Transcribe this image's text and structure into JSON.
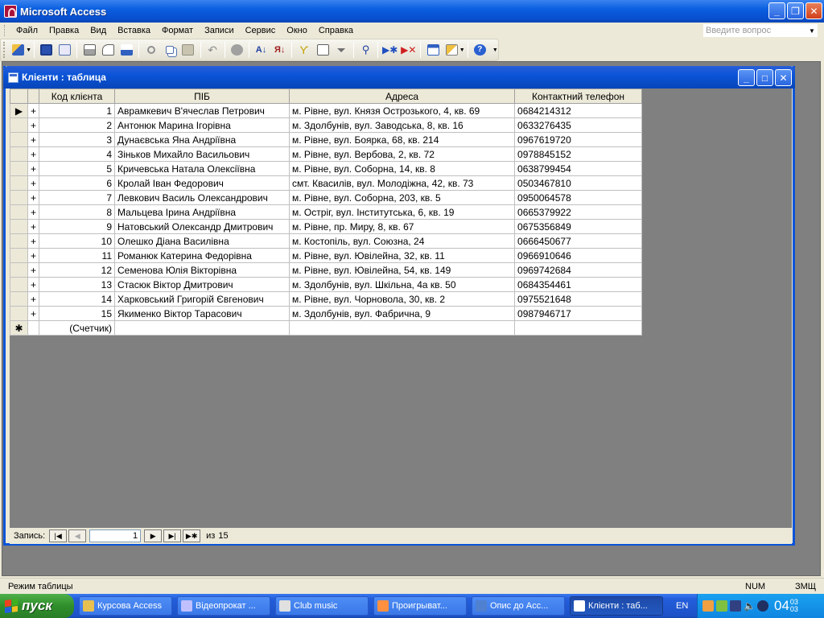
{
  "app": {
    "title": "Microsoft Access"
  },
  "menu": {
    "items": [
      "Файл",
      "Правка",
      "Вид",
      "Вставка",
      "Формат",
      "Записи",
      "Сервис",
      "Окно",
      "Справка"
    ],
    "help_placeholder": "Введите вопрос"
  },
  "toolbar": {
    "icons": [
      "design-view-icon",
      "save-icon",
      "search-file-icon",
      "print-icon",
      "print-preview-icon",
      "spelling-icon",
      "cut-icon",
      "copy-icon",
      "paste-icon",
      "undo-icon",
      "hyperlink-icon",
      "sort-ascending-icon",
      "sort-descending-icon",
      "filter-by-selection-icon",
      "filter-by-form-icon",
      "apply-filter-icon",
      "find-icon",
      "new-record-icon",
      "delete-record-icon",
      "database-window-icon",
      "new-object-icon",
      "help-icon"
    ]
  },
  "window": {
    "title": "Клієнти : таблица"
  },
  "table": {
    "columns": [
      "Код клієнта",
      "ПІБ",
      "Адреса",
      "Контактний телефон"
    ],
    "rows": [
      {
        "id": "1",
        "name": "Аврамкевич В'ячеслав Петрович",
        "address": "м. Рівне, вул. Князя Острозького, 4, кв. 69",
        "phone": "0684214312"
      },
      {
        "id": "2",
        "name": "Антонюк Марина Ігорівна",
        "address": "м. Здолбунів, вул. Заводська, 8, кв. 16",
        "phone": "0633276435"
      },
      {
        "id": "3",
        "name": "Дунаєвська Яна Андріївна",
        "address": "м. Рівне, вул. Боярка, 68, кв. 214",
        "phone": "0967619720"
      },
      {
        "id": "4",
        "name": "Зіньков Михайло Васильович",
        "address": "м. Рівне, вул. Вербова, 2, кв. 72",
        "phone": "0978845152"
      },
      {
        "id": "5",
        "name": "Кричевська Натала Олексіївна",
        "address": "м. Рівне, вул. Соборна, 14, кв. 8",
        "phone": "0638799454"
      },
      {
        "id": "6",
        "name": "Кролай Іван Федорович",
        "address": "смт. Квасилів, вул. Молодіжна, 42, кв. 73",
        "phone": "0503467810"
      },
      {
        "id": "7",
        "name": "Левкович Василь Олександрович",
        "address": "м. Рівне, вул. Соборна, 203, кв. 5",
        "phone": "0950064578"
      },
      {
        "id": "8",
        "name": "Мальцева Ірина Андріївна",
        "address": "м. Остріг, вул. Інститутська, 6, кв. 19",
        "phone": "0665379922"
      },
      {
        "id": "9",
        "name": "Натовський Олександр Дмитрович",
        "address": "м. Рівне, пр. Миру, 8, кв. 67",
        "phone": "0675356849"
      },
      {
        "id": "10",
        "name": "Олешко Діана Василівна",
        "address": "м. Костопіль, вул. Союзна, 24",
        "phone": "0666450677"
      },
      {
        "id": "11",
        "name": "Романюк Катерина Федорівна",
        "address": "м. Рівне, вул. Ювілейна, 32, кв. 11",
        "phone": "0966910646"
      },
      {
        "id": "12",
        "name": "Семенова Юлія Вікторівна",
        "address": "м. Рівне, вул. Ювілейна, 54, кв. 149",
        "phone": "0969742684"
      },
      {
        "id": "13",
        "name": "Стасюк Віктор Дмитрович",
        "address": "м. Здолбунів, вул. Шкільна, 4а  кв. 50",
        "phone": "0684354461"
      },
      {
        "id": "14",
        "name": "Харковський Григорій Євгенович",
        "address": "м. Рівне, вул. Чорновола, 30, кв. 2",
        "phone": "0975521648"
      },
      {
        "id": "15",
        "name": "Якименко Віктор Тарасович",
        "address": "м. Здолбунів, вул. Фабрична, 9",
        "phone": "0987946717"
      }
    ],
    "new_row_label": "(Счетчик)",
    "expand_symbol": "+",
    "new_row_symbol": "✱",
    "current_row_symbol": "▶"
  },
  "navigation": {
    "label": "Запись:",
    "current": "1",
    "of_label": "из",
    "total": "15"
  },
  "status": {
    "text": "Режим таблицы",
    "num": "NUM",
    "mode": "ЗМЩ"
  },
  "taskbar": {
    "start_label": "пуск",
    "tasks": [
      {
        "label": "Курсова Access",
        "color": "#e8c050"
      },
      {
        "label": "Відеопрокат ...",
        "color": "#c0c0ff"
      },
      {
        "label": "Club music",
        "color": "#e0e0e0"
      },
      {
        "label": "Проигрыват...",
        "color": "#ff9040"
      },
      {
        "label": "Опис до Acc...",
        "color": "#5080d0"
      },
      {
        "label": "Клієнти : таб...",
        "color": "#ffffff"
      }
    ],
    "lang": "EN",
    "clock": {
      "hours": "04",
      "minutes": "03",
      "seconds": "03"
    }
  },
  "colors": {
    "titlebar": "#0a5fe0",
    "workspace": "#808080",
    "taskbar": "#245edb",
    "start": "#2f8f2b"
  }
}
